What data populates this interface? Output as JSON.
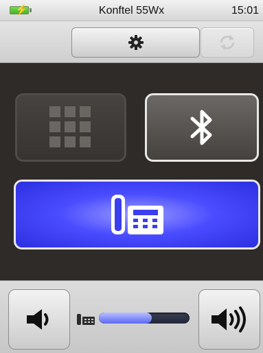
{
  "status": {
    "device_name": "Konftel 55Wx",
    "time": "15:01",
    "battery_icon": "battery-charging-icon"
  },
  "toolbar": {
    "settings_icon": "gear-icon",
    "sync_icon": "sync-icon",
    "sync_enabled": false
  },
  "modes": [
    {
      "name": "keypad",
      "icon": "keypad-grid-icon",
      "enabled": false
    },
    {
      "name": "bluetooth",
      "icon": "bluetooth-icon",
      "enabled": true
    },
    {
      "name": "desk-phone",
      "icon": "desk-phone-icon",
      "selected": true
    }
  ],
  "volume": {
    "level": 0.58,
    "down_icon": "volume-down-icon",
    "up_icon": "volume-up-icon",
    "source_icon": "desk-phone-icon"
  },
  "colors": {
    "accent": "#4a4cff",
    "battery": "#4cc62a"
  }
}
